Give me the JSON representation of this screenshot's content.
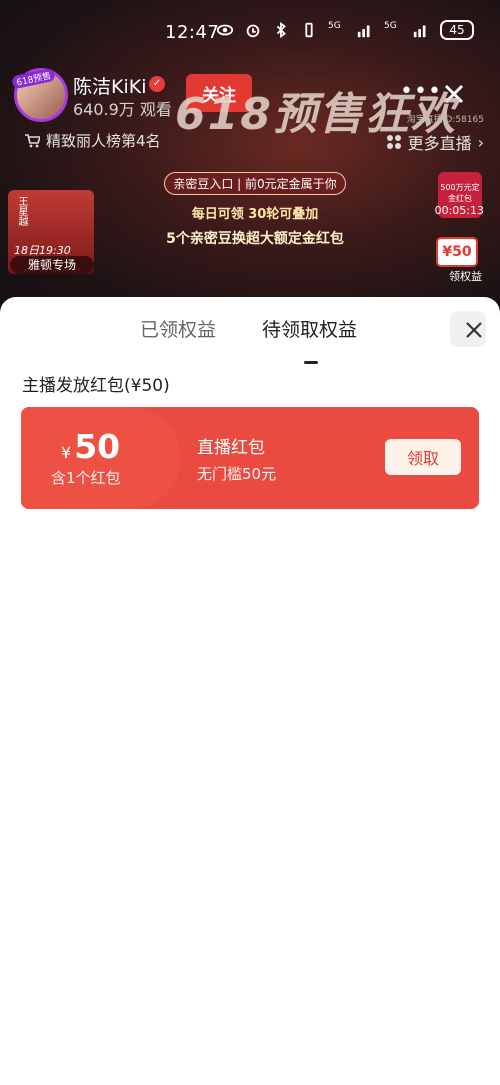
{
  "status_bar": {
    "time": "12:47",
    "battery": "45",
    "network1": "5G",
    "network2": "5G"
  },
  "live": {
    "avatar_tag": "618预售",
    "host_name": "陈洁KiKi",
    "viewers": "640.9万 观看",
    "follow_label": "关注",
    "more_label": "•••",
    "banner_title": "618预售狂欢",
    "ranking": "精致丽人榜第4名",
    "more_live": "更多直播",
    "room_id": "淘宝直播ID:58165",
    "promo_line1": "亲密豆入口 | 前0元定金属于你",
    "promo_line2": "每日可领 30轮可叠加",
    "promo_line3": "5个亲密豆换超大额定金红包",
    "anchor_name": "王星越",
    "anchor_time": "18日19:30",
    "anchor_special": "雅顿专场",
    "widget1_text": "500万元定金红包",
    "timer": "00:05:13",
    "widget2_text": "¥50",
    "benefit_label": "领权益"
  },
  "sheet": {
    "tab_received": "已领权益",
    "tab_pending": "待领取权益",
    "section_title": "主播发放红包(¥50)",
    "coupon": {
      "currency": "¥",
      "amount": "50",
      "count": "含1个红包",
      "title": "直播红包",
      "desc": "无门槛50元",
      "claim_label": "领取"
    }
  },
  "colors": {
    "accent_red": "#ea4a3f",
    "claim_bg": "#fdf3ea"
  }
}
